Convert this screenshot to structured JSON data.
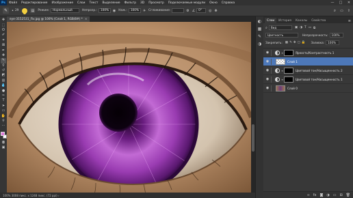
{
  "menu": {
    "logo": "Ps",
    "items": [
      "Файл",
      "Редактирование",
      "Изображение",
      "Слои",
      "Текст",
      "Выделение",
      "Фильтр",
      "3D",
      "Просмотр",
      "Подключаемые модули",
      "Окно",
      "Справка"
    ]
  },
  "window_controls": [
    "—",
    "□",
    "✕"
  ],
  "options": {
    "brush_size": "29",
    "mode_label": "Режим:",
    "mode_value": "Нормальный",
    "opacity_label": "Непрозр.:",
    "opacity_value": "100%",
    "pressure_label": "Наж.:",
    "pressure_value": "100%",
    "smoothing_label": "Сглаживание:",
    "smoothing_value": "",
    "angle_value": "0°"
  },
  "document": {
    "tab_title": "eye-3152531_Fiv.jpg @ 100% (Слой 1, RGB/8#) *",
    "close": "×"
  },
  "status": {
    "text": "100%   3008 пикс. x 1248 пикс. (72 ppi)   ›"
  },
  "layers_panel": {
    "tabs": [
      "Слои",
      "История",
      "Каналы",
      "Свойства"
    ],
    "active_tab": 0,
    "filter_label": "Вид",
    "blend_mode": "Цветность",
    "opacity_label": "Непрозрачность:",
    "opacity_value": "100%",
    "lock_label": "Закрепить:",
    "fill_label": "Заливка:",
    "fill_value": "100%",
    "layers": [
      {
        "name": "Яркость/Контрастность 1",
        "kind": "adjustment",
        "selected": false
      },
      {
        "name": "Слой 1",
        "kind": "pixel",
        "selected": true
      },
      {
        "name": "Цветовой тон/Насыщенность 2",
        "kind": "adjustment",
        "selected": false
      },
      {
        "name": "Цветовой тон/Насыщенность 1",
        "kind": "adjustment",
        "selected": false
      },
      {
        "name": "Слой 0",
        "kind": "image",
        "selected": false
      }
    ]
  },
  "colors": {
    "accent_selection": "#4d78b9",
    "foreground": "#e17bd9",
    "background": "#ffffff"
  }
}
